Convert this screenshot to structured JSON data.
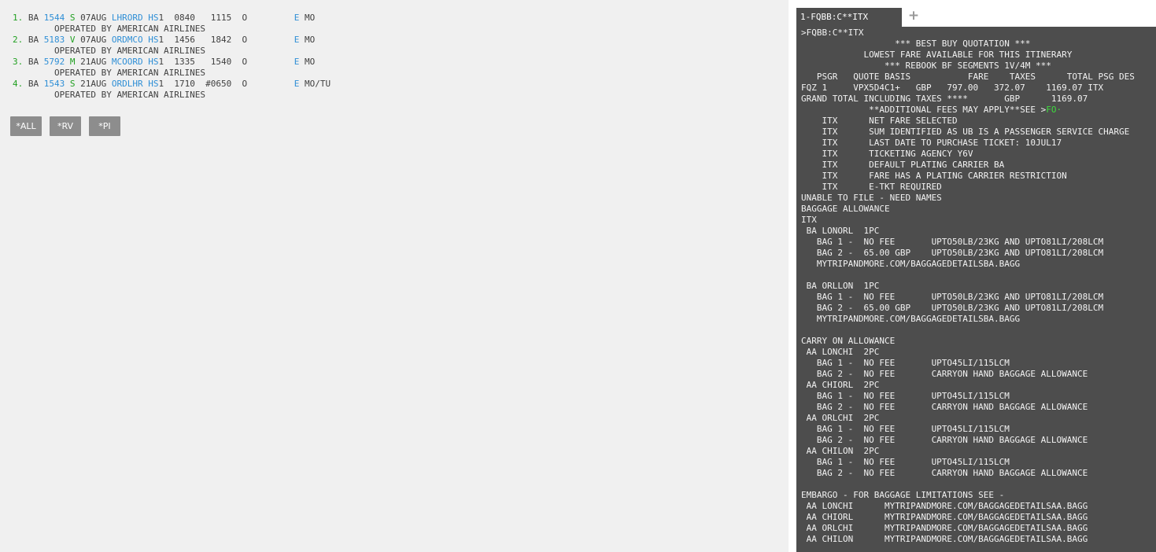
{
  "itinerary": {
    "segments": [
      {
        "num": "1.",
        "airline": "BA",
        "flight": "1544",
        "cls": "S",
        "date": "07AUG",
        "city_pair": "LHRORD",
        "status": "HS",
        "qty": "1",
        "dep": "0840",
        "arr": "1115",
        "col_o": "O",
        "e": "E",
        "day": "MO",
        "operated_by": "OPERATED BY AMERICAN AIRLINES"
      },
      {
        "num": "2.",
        "airline": "BA",
        "flight": "5183",
        "cls": "V",
        "date": "07AUG",
        "city_pair": "ORDMCO",
        "status": "HS",
        "qty": "1",
        "dep": "1456",
        "arr": "1842",
        "col_o": "O",
        "e": "E",
        "day": "MO",
        "operated_by": "OPERATED BY AMERICAN AIRLINES"
      },
      {
        "num": "3.",
        "airline": "BA",
        "flight": "5792",
        "cls": "M",
        "date": "21AUG",
        "city_pair": "MCOORD",
        "status": "HS",
        "qty": "1",
        "dep": "1335",
        "arr": "1540",
        "col_o": "O",
        "e": "E",
        "day": "MO",
        "operated_by": "OPERATED BY AMERICAN AIRLINES"
      },
      {
        "num": "4.",
        "airline": "BA",
        "flight": "1543",
        "cls": "S",
        "date": "21AUG",
        "city_pair": "ORDLHR",
        "status": "HS",
        "qty": "1",
        "dep": "1710",
        "arr": "#0650",
        "col_o": "O",
        "e": "E",
        "day": "MO/TU",
        "operated_by": "OPERATED BY AMERICAN AIRLINES"
      }
    ]
  },
  "buttons": [
    {
      "id": "all",
      "label": "*ALL"
    },
    {
      "id": "rv",
      "label": "*RV"
    },
    {
      "id": "pi",
      "label": "*PI"
    }
  ],
  "terminal": {
    "tab_label": "1-FQBB:C**ITX",
    "add_tab_icon": "plus-icon",
    "line_color": "#f2f2f2",
    "highlight_color": "#3ddc3d",
    "lines": [
      ">FQBB:C**ITX",
      "                  *** BEST BUY QUOTATION ***",
      "            LOWEST FARE AVAILABLE FOR THIS ITINERARY",
      "                *** REBOOK BF SEGMENTS 1V/4M ***",
      "   PSGR   QUOTE BASIS           FARE    TAXES      TOTAL PSG DES",
      "FQZ 1     VPX5D4C1+   GBP   797.00   372.07    1169.07 ITX",
      "GRAND TOTAL INCLUDING TAXES ****       GBP      1169.07",
      "             **ADDITIONAL FEES MAY APPLY**SEE >",
      "    ITX      NET FARE SELECTED",
      "    ITX      SUM IDENTIFIED AS UB IS A PASSENGER SERVICE CHARGE",
      "    ITX      LAST DATE TO PURCHASE TICKET: 10JUL17",
      "    ITX      TICKETING AGENCY Y6V",
      "    ITX      DEFAULT PLATING CARRIER BA",
      "    ITX      FARE HAS A PLATING CARRIER RESTRICTION",
      "    ITX      E-TKT REQUIRED",
      "UNABLE TO FILE - NEED NAMES",
      "BAGGAGE ALLOWANCE",
      "ITX",
      " BA LONORL  1PC",
      "   BAG 1 -  NO FEE       UPTO50LB/23KG AND UPTO81LI/208LCM",
      "   BAG 2 -  65.00 GBP    UPTO50LB/23KG AND UPTO81LI/208LCM",
      "   MYTRIPANDMORE.COM/BAGGAGEDETAILSBA.BAGG",
      "",
      " BA ORLLON  1PC",
      "   BAG 1 -  NO FEE       UPTO50LB/23KG AND UPTO81LI/208LCM",
      "   BAG 2 -  65.00 GBP    UPTO50LB/23KG AND UPTO81LI/208LCM",
      "   MYTRIPANDMORE.COM/BAGGAGEDETAILSBA.BAGG",
      "",
      "CARRY ON ALLOWANCE",
      " AA LONCHI  2PC",
      "   BAG 1 -  NO FEE       UPTO45LI/115LCM",
      "   BAG 2 -  NO FEE       CARRYON HAND BAGGAGE ALLOWANCE",
      " AA CHIORL  2PC",
      "   BAG 1 -  NO FEE       UPTO45LI/115LCM",
      "   BAG 2 -  NO FEE       CARRYON HAND BAGGAGE ALLOWANCE",
      " AA ORLCHI  2PC",
      "   BAG 1 -  NO FEE       UPTO45LI/115LCM",
      "   BAG 2 -  NO FEE       CARRYON HAND BAGGAGE ALLOWANCE",
      " AA CHILON  2PC",
      "   BAG 1 -  NO FEE       UPTO45LI/115LCM",
      "   BAG 2 -  NO FEE       CARRYON HAND BAGGAGE ALLOWANCE",
      "",
      "EMBARGO - FOR BAGGAGE LIMITATIONS SEE -",
      " AA LONCHI      MYTRIPANDMORE.COM/BAGGAGEDETAILSAA.BAGG",
      " AA CHIORL      MYTRIPANDMORE.COM/BAGGAGEDETAILSAA.BAGG",
      " AA ORLCHI      MYTRIPANDMORE.COM/BAGGAGEDETAILSAA.BAGG",
      " AA CHILON      MYTRIPANDMORE.COM/BAGGAGEDETAILSAA.BAGG"
    ],
    "fo_link_line": 7,
    "fo_link_text": "FO",
    "fo_link_suffix": "·"
  }
}
